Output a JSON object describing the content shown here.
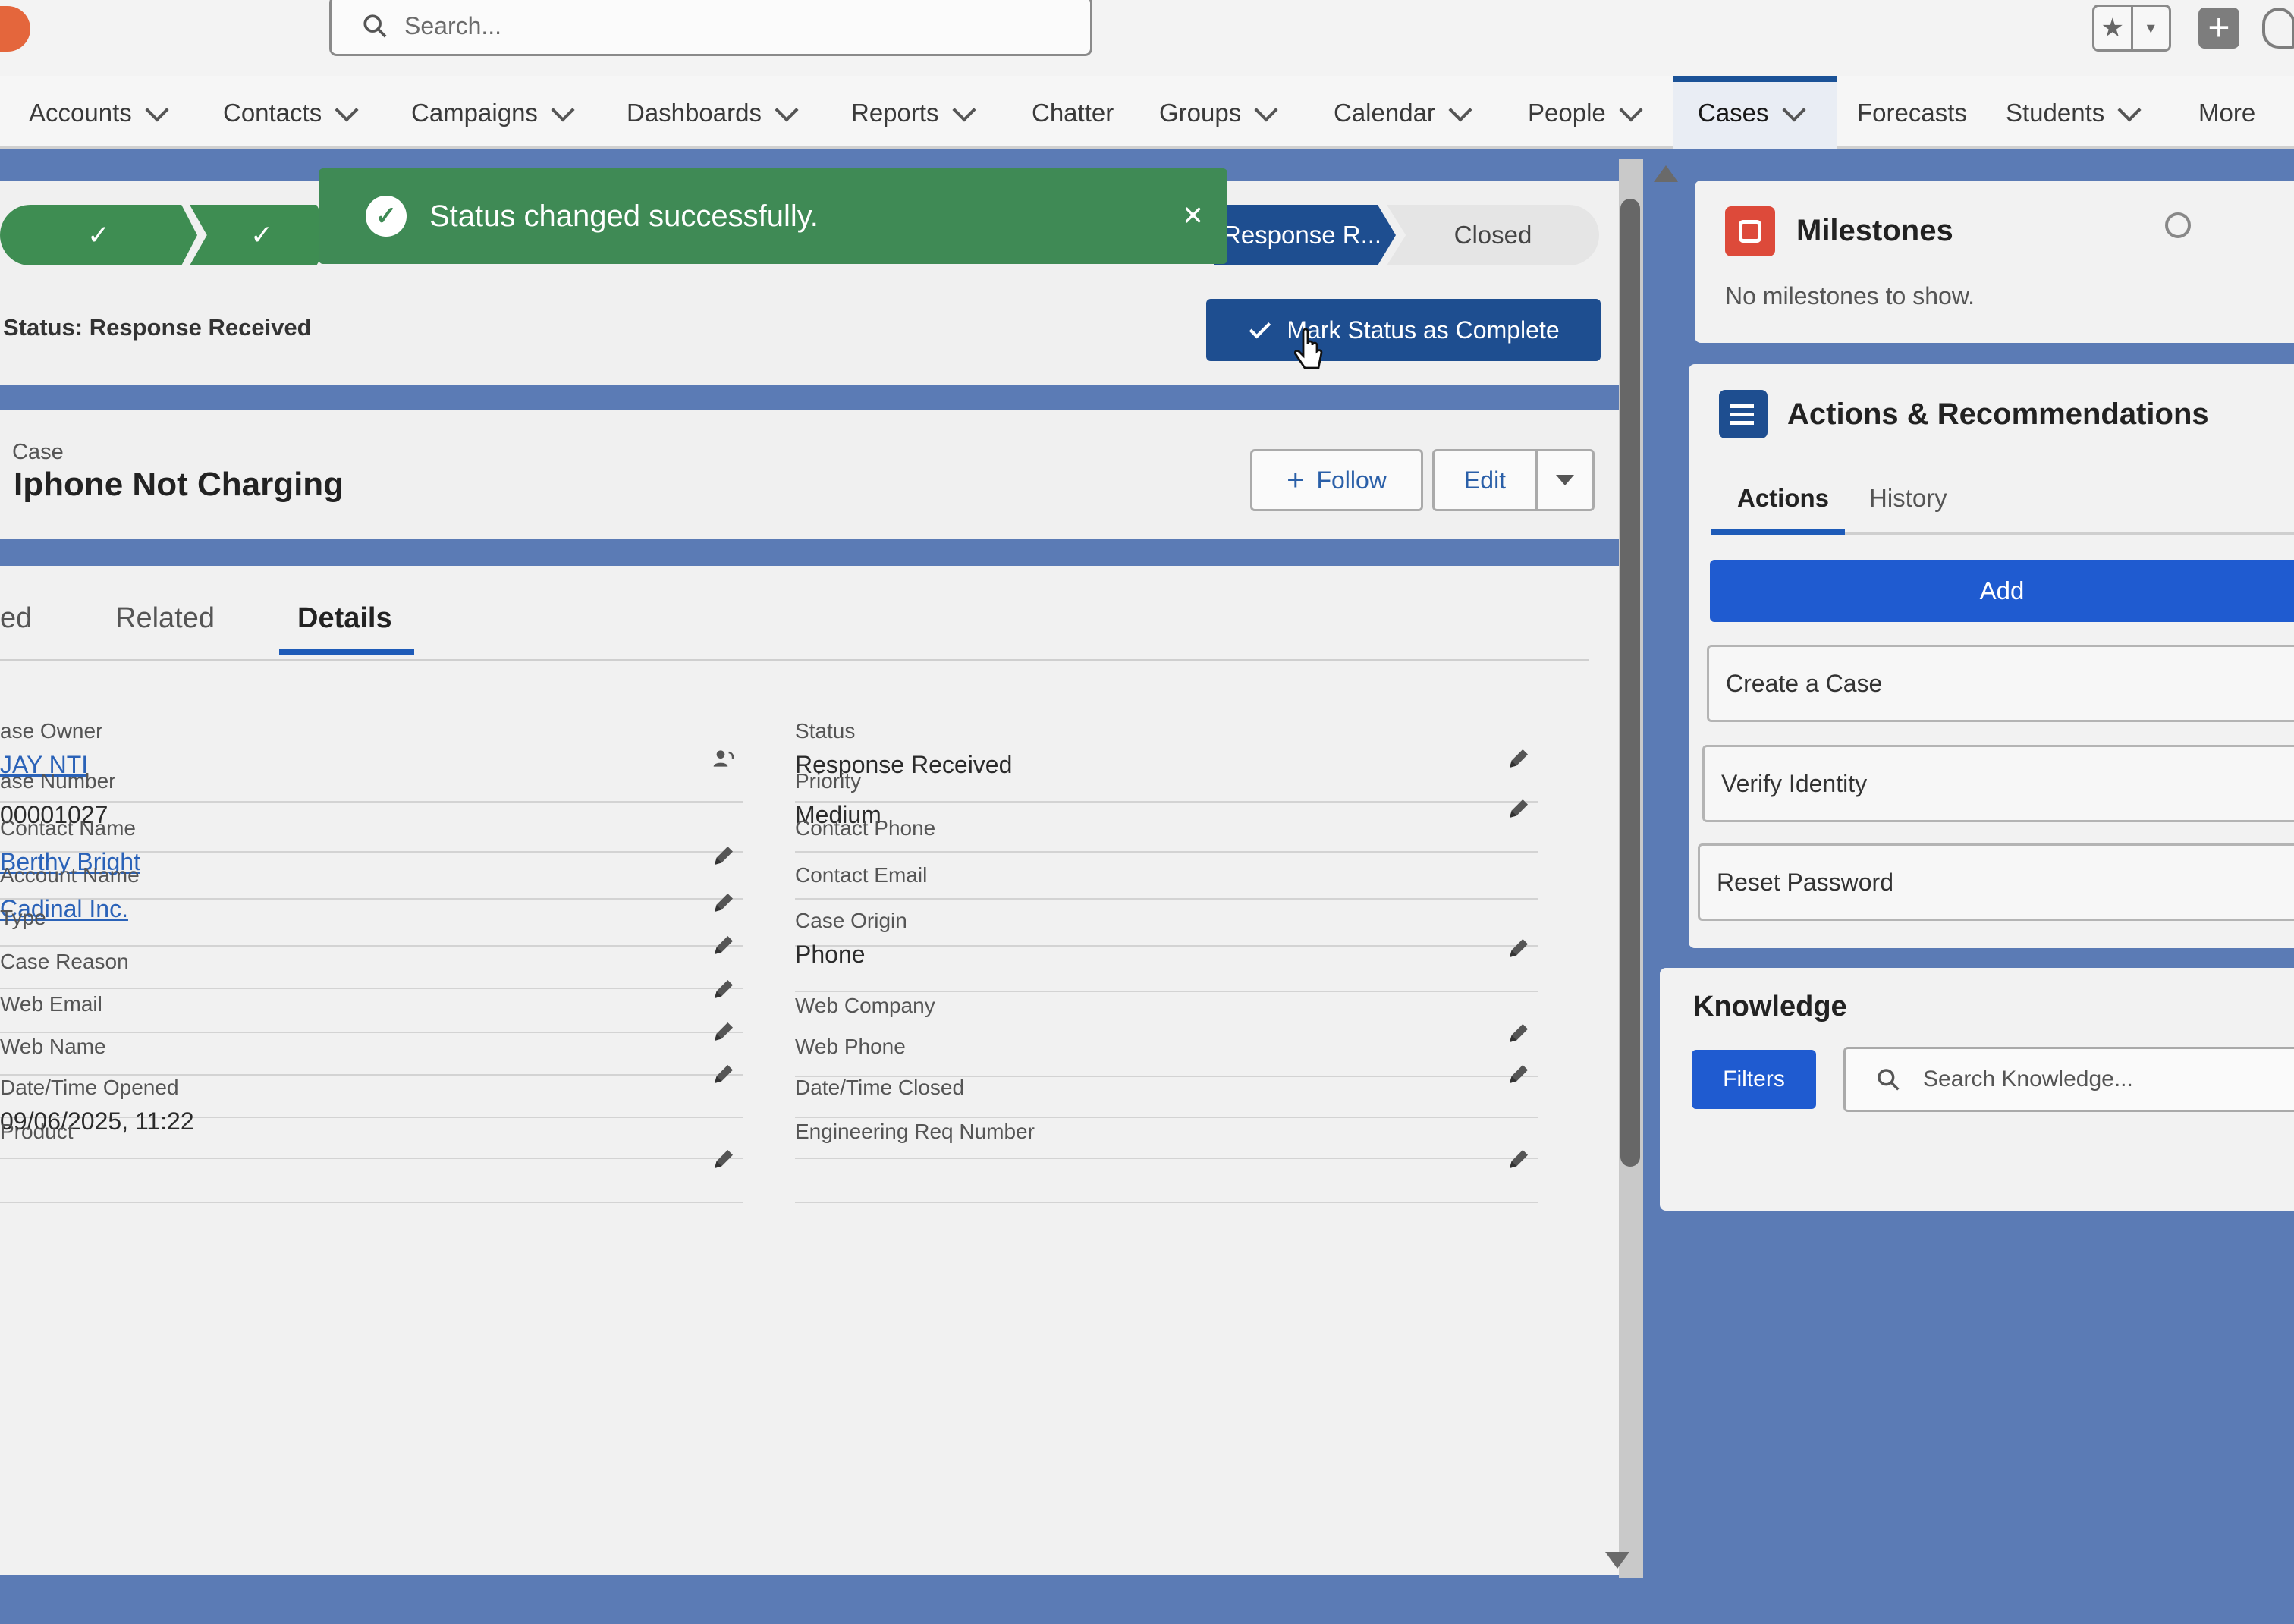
{
  "header": {
    "search_placeholder": "Search...",
    "favorites_star": "★",
    "favorites_dropdown": "▾",
    "add_plus": "+"
  },
  "nav": {
    "items": [
      {
        "label": "Accounts",
        "has_menu": true
      },
      {
        "label": "Contacts",
        "has_menu": true
      },
      {
        "label": "Campaigns",
        "has_menu": true
      },
      {
        "label": "Dashboards",
        "has_menu": true
      },
      {
        "label": "Reports",
        "has_menu": true
      },
      {
        "label": "Chatter",
        "has_menu": false
      },
      {
        "label": "Groups",
        "has_menu": true
      },
      {
        "label": "Calendar",
        "has_menu": true
      },
      {
        "label": "People",
        "has_menu": true
      },
      {
        "label": "Cases",
        "has_menu": true,
        "active": true
      },
      {
        "label": "Forecasts",
        "has_menu": false
      },
      {
        "label": "Students",
        "has_menu": true
      },
      {
        "label": "More",
        "has_menu": false
      }
    ]
  },
  "path": {
    "completed_check": "✓",
    "current_stage": "Response R...",
    "closed_stage": "Closed",
    "status_label": "Status:",
    "status_value": "Response Received",
    "mark_complete": "Mark Status as Complete",
    "colors": {
      "done": "#3e8d52",
      "current": "#1e4e90"
    }
  },
  "toast": {
    "message": "Status changed successfully.",
    "close": "×",
    "color": "#3f8a55"
  },
  "record": {
    "kicker": "Case",
    "title": "Iphone Not Charging",
    "follow_label": "Follow",
    "edit_label": "Edit"
  },
  "tabs": [
    {
      "label": "ed"
    },
    {
      "label": "Related"
    },
    {
      "label": "Details",
      "active": true
    }
  ],
  "fields_left": [
    {
      "label": "ase Owner",
      "value": "JAY NTI",
      "link": true,
      "icon": "change-owner-icon"
    },
    {
      "label": "ase Number",
      "value": "00001027"
    },
    {
      "label": "Contact Name",
      "value": "Berthy Bright",
      "link": true,
      "editable": true
    },
    {
      "label": "Account Name",
      "value": "Cadinal Inc.",
      "link": true,
      "editable": true
    },
    {
      "label": "Type",
      "value": "",
      "editable": true
    },
    {
      "label": "Case Reason",
      "value": "",
      "editable": true
    },
    {
      "label": "Web Email",
      "value": "",
      "editable": true
    },
    {
      "label": "Web Name",
      "value": "",
      "editable": true
    },
    {
      "label": "Date/Time Opened",
      "value": "09/06/2025, 11:22"
    },
    {
      "label": "Product",
      "value": "",
      "editable": true
    }
  ],
  "fields_right": [
    {
      "label": "Status",
      "value": "Response Received",
      "editable": true
    },
    {
      "label": "Priority",
      "value": "Medium",
      "editable": true
    },
    {
      "label": "Contact Phone",
      "value": ""
    },
    {
      "label": "Contact Email",
      "value": ""
    },
    {
      "label": "Case Origin",
      "value": "Phone",
      "editable": true
    },
    {
      "label": "Web Company",
      "value": "",
      "editable": true
    },
    {
      "label": "Web Phone",
      "value": "",
      "editable": true
    },
    {
      "label": "Date/Time Closed",
      "value": ""
    },
    {
      "label": "Engineering Req Number",
      "value": "",
      "editable": true
    }
  ],
  "milestones": {
    "title": "Milestones",
    "empty": "No milestones to show."
  },
  "actions": {
    "title": "Actions & Recommendations",
    "tab_actions": "Actions",
    "tab_history": "History",
    "add_label": "Add",
    "items": [
      "Create a Case",
      "Verify Identity",
      "Reset Password"
    ]
  },
  "knowledge": {
    "title": "Knowledge",
    "filters_label": "Filters",
    "search_placeholder": "Search Knowledge..."
  }
}
